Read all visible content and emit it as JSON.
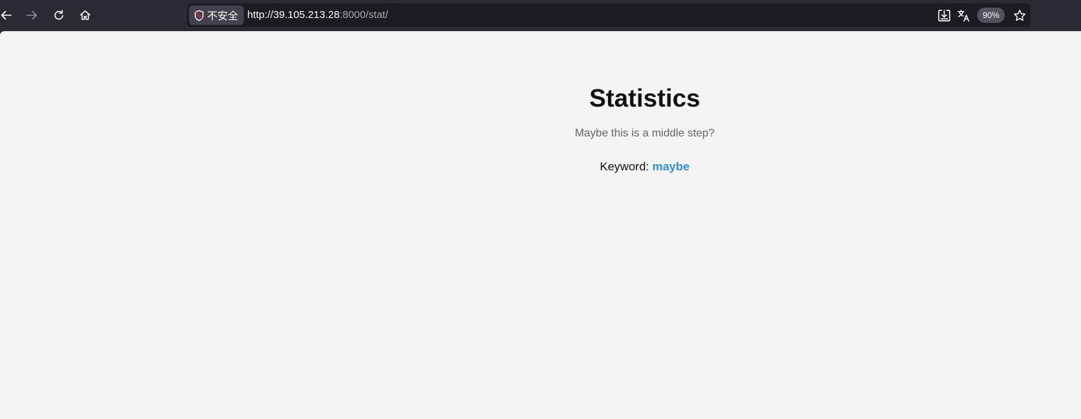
{
  "browser": {
    "security_label": "不安全",
    "url_host": "http://39.105.213.28",
    "url_rest": ":8000/stat/",
    "zoom": "90%",
    "icons": [
      "back-icon",
      "forward-icon",
      "reload-icon",
      "home-icon",
      "insecure-shield-icon",
      "download-icon",
      "translate-icon",
      "bookmark-star-icon"
    ],
    "colors": {
      "chrome_bg": "#2b2a33",
      "urlbar_bg": "#1c1b22",
      "shield_red": "#e22850"
    }
  },
  "page": {
    "title": "Statistics",
    "subtitle": "Maybe this is a middle step?",
    "keyword_label": "Keyword: ",
    "keyword_value": "maybe",
    "colors": {
      "background": "#f4f4f4",
      "keyword_accent": "#2f8fdd"
    }
  }
}
